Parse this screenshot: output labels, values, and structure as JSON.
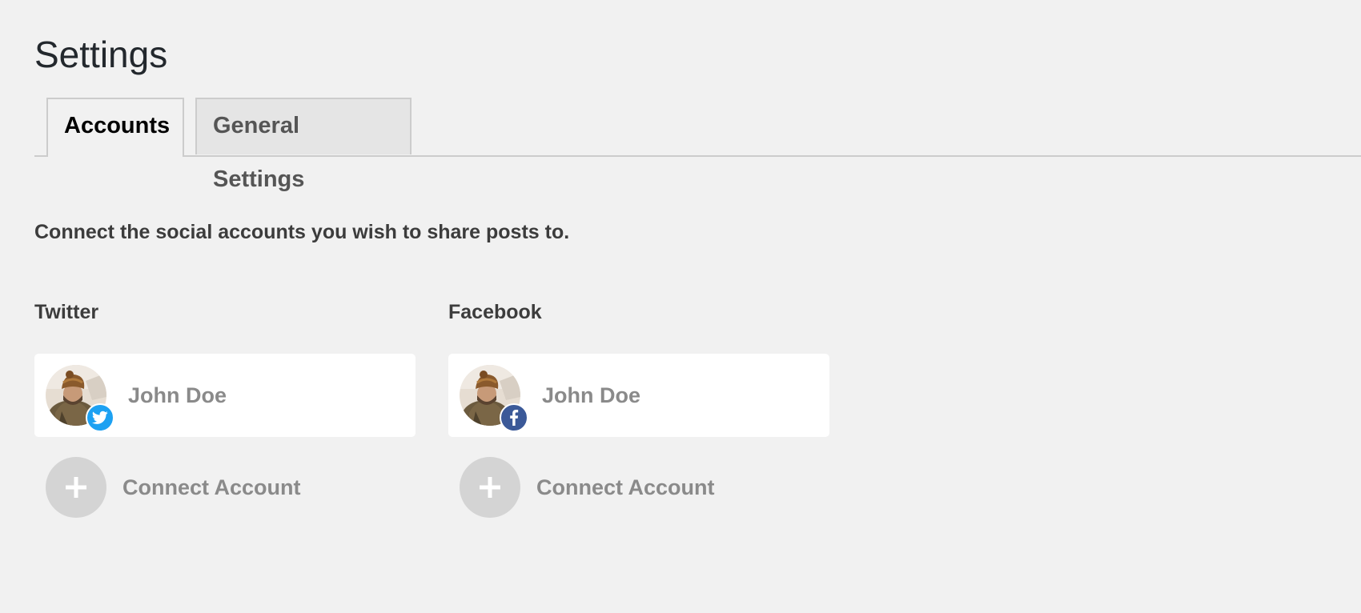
{
  "page": {
    "title": "Settings"
  },
  "tabs": [
    {
      "label": "Accounts",
      "active": true
    },
    {
      "label": "General Settings",
      "active": false
    }
  ],
  "intro": "Connect the social accounts you wish to share posts to.",
  "networks": [
    {
      "name": "Twitter",
      "badge_icon": "twitter-icon",
      "badge_color": "#1da1f2",
      "accounts": [
        {
          "name": "John Doe"
        }
      ],
      "connect_label": "Connect Account"
    },
    {
      "name": "Facebook",
      "badge_icon": "facebook-icon",
      "badge_color": "#3b5998",
      "accounts": [
        {
          "name": "John Doe"
        }
      ],
      "connect_label": "Connect Account"
    }
  ],
  "colors": {
    "background": "#f1f1f1",
    "card": "#ffffff",
    "muted_text": "#8a8a8a",
    "plus_circle": "#d4d4d4"
  }
}
